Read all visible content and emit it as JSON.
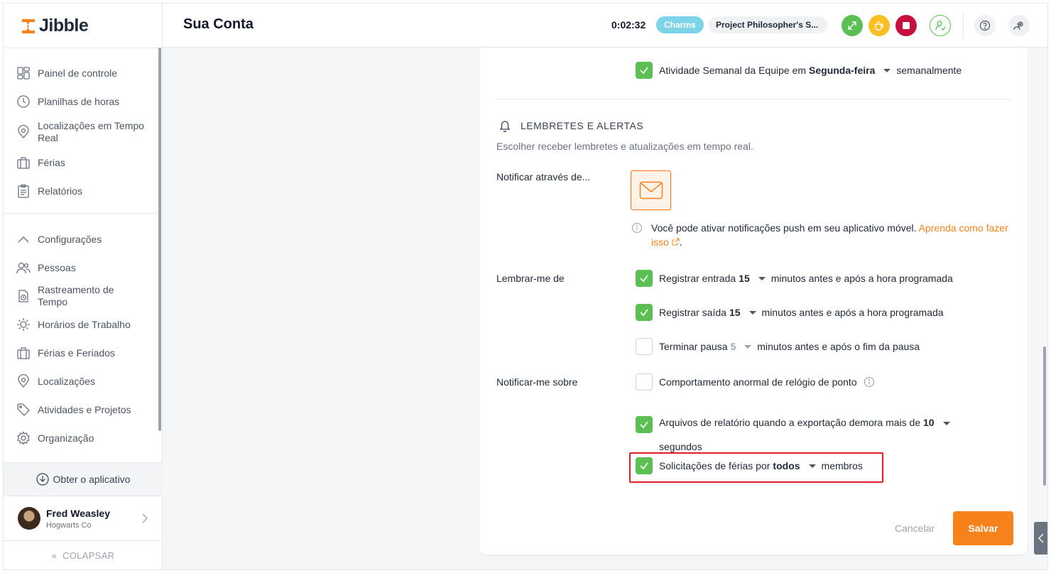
{
  "app": {
    "name": "Jibble"
  },
  "sidebar": {
    "primary": [
      {
        "label": "Painel de controle",
        "icon": "dashboard-icon"
      },
      {
        "label": "Planilhas de horas",
        "icon": "clock-icon"
      },
      {
        "label": "Localizações em Tempo Real",
        "icon": "location-pin-icon"
      },
      {
        "label": "Férias",
        "icon": "briefcase-icon"
      },
      {
        "label": "Relatórios",
        "icon": "clipboard-icon"
      }
    ],
    "settings": [
      {
        "label": "Configurações",
        "icon": "chevron-up-icon"
      },
      {
        "label": "Pessoas",
        "icon": "people-icon"
      },
      {
        "label": "Rastreamento de Tempo",
        "icon": "time-tracking-icon"
      },
      {
        "label": "Horários de Trabalho",
        "icon": "work-schedule-icon"
      },
      {
        "label": "Férias e Feriados",
        "icon": "briefcase-icon"
      },
      {
        "label": "Localizações",
        "icon": "location-pin-icon"
      },
      {
        "label": "Atividades e Projetos",
        "icon": "tag-icon"
      },
      {
        "label": "Organização",
        "icon": "gear-icon"
      }
    ],
    "get_app": "Obter o aplicativo",
    "user": {
      "name": "Fred Weasley",
      "org": "Hogwarts Co"
    },
    "collapse": "COLAPSAR"
  },
  "header": {
    "title": "Sua Conta",
    "timer": "0:02:32",
    "activity": "Charms",
    "project": "Project Philosopher's S..."
  },
  "content": {
    "weekly": {
      "text_pre": "Atividade Semanal da Equipe em",
      "day": "Segunda-feira",
      "text_post": "semanalmente",
      "checked": true
    },
    "section": {
      "title": "LEMBRETES E ALERTAS",
      "subtitle": "Escolher receber lembretes e atualizações em tempo real."
    },
    "notify_via": {
      "label": "Notificar através de...",
      "info": "Você pode ativar notificações push em seu aplicativo móvel.",
      "link": "Aprenda como fazer isso",
      "period": "."
    },
    "remind": {
      "label": "Lembrar-me de",
      "items": [
        {
          "pre": "Registrar entrada",
          "value": "15",
          "post": "minutos antes e após a hora programada",
          "checked": true
        },
        {
          "pre": "Registrar saída",
          "value": "15",
          "post": "minutos antes e após a hora programada",
          "checked": true
        },
        {
          "pre": "Terminar pausa",
          "value": "5",
          "post": "minutos antes e após o fim da pausa",
          "checked": false
        }
      ]
    },
    "notify_about": {
      "label": "Notificar-me sobre",
      "abnormal": {
        "text": "Comportamento anormal de relógio de ponto",
        "checked": false
      },
      "reports": {
        "pre": "Arquivos de relatório quando a exportação demora mais de",
        "value": "10",
        "post": "segundos",
        "checked": true
      },
      "vacation": {
        "pre": "Solicitações de férias por",
        "value": "todos",
        "post": "membros",
        "checked": true
      }
    },
    "actions": {
      "cancel": "Cancelar",
      "save": "Salvar"
    }
  },
  "colors": {
    "accent": "#f7821b",
    "checkbox_on": "#5cbf53",
    "highlight": "#e11d2a",
    "charms_chip": "#7dd3e8",
    "btn_green": "#5cbf53",
    "btn_yellow": "#fbbf24",
    "btn_red": "#c8103e"
  }
}
